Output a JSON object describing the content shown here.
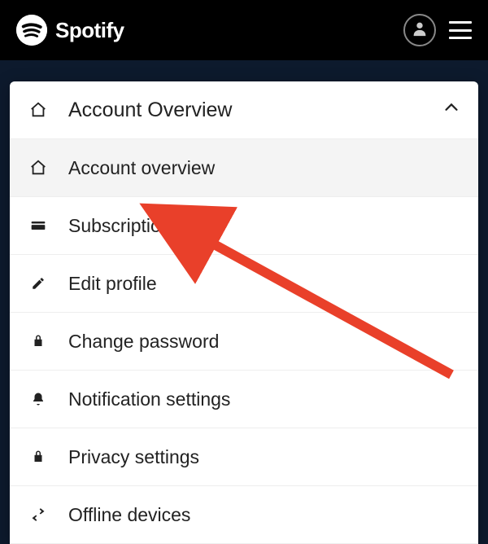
{
  "brand": {
    "name": "Spotify"
  },
  "menu": {
    "header": {
      "label": "Account Overview"
    },
    "items": [
      {
        "key": "overview",
        "label": "Account overview",
        "icon": "home-icon",
        "selected": true
      },
      {
        "key": "subscription",
        "label": "Subscription",
        "icon": "card-icon",
        "selected": false
      },
      {
        "key": "edit_profile",
        "label": "Edit profile",
        "icon": "pencil-icon",
        "selected": false
      },
      {
        "key": "change_pw",
        "label": "Change password",
        "icon": "lock-icon",
        "selected": false
      },
      {
        "key": "notifications",
        "label": "Notification settings",
        "icon": "bell-icon",
        "selected": false
      },
      {
        "key": "privacy",
        "label": "Privacy settings",
        "icon": "lock-icon",
        "selected": false
      },
      {
        "key": "offline",
        "label": "Offline devices",
        "icon": "swap-icon",
        "selected": false
      }
    ]
  },
  "colors": {
    "annotation_arrow": "#e9402a"
  }
}
